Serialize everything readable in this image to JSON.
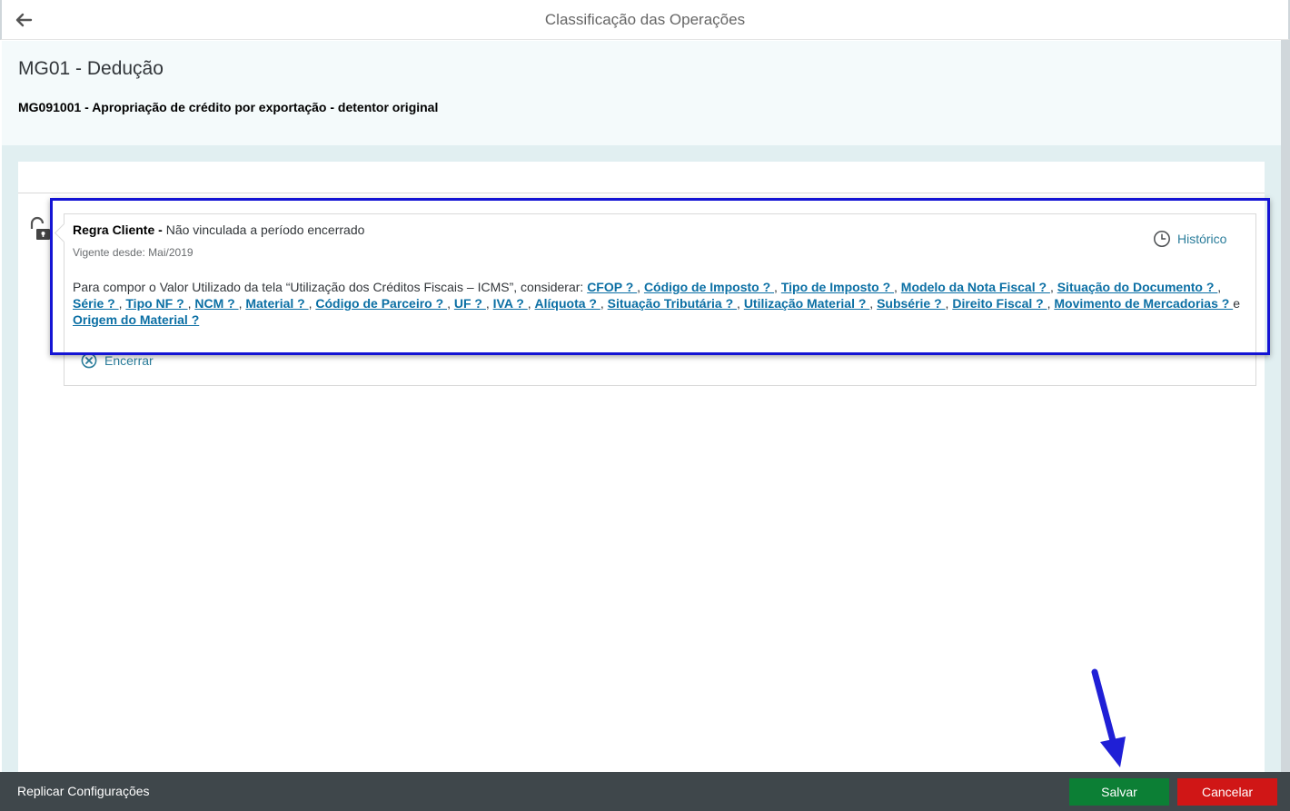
{
  "header": {
    "title": "Classificação das Operações"
  },
  "object": {
    "title": "MG01 - Dedução",
    "subtitle": "MG091001 - Apropriação de crédito por exportação - detentor original"
  },
  "rule": {
    "label_strong": "Regra Cliente -",
    "label_status": " Não vinculada a período encerrado",
    "since": "Vigente desde: Mai/2019",
    "history_label": "Histórico",
    "intro": "Para compor o Valor Utilizado da tela “Utilização dos Créditos Fiscais – ICMS”, considerar: ",
    "links": [
      "CFOP ? ",
      "Código de Imposto ? ",
      "Tipo de Imposto ? ",
      "Modelo da Nota Fiscal ? ",
      "Situação do Documento ? ",
      "Série ? ",
      "Tipo NF ? ",
      "NCM ? ",
      "Material ? ",
      "Código de Parceiro ? ",
      "UF ? ",
      "IVA ? ",
      "Alíquota ? ",
      "Situação Tributária ? ",
      "Utilização Material ? ",
      "Subsérie ? ",
      "Direito Fiscal ? ",
      "Movimento de Mercadorias ? ",
      "Origem do Material ?"
    ],
    "sep": ", ",
    "and": "e ",
    "close_label": "Encerrar"
  },
  "footer": {
    "replicate_label": "Replicar Configurações",
    "save_label": "Salvar",
    "cancel_label": "Cancelar"
  },
  "colors": {
    "save": "#0c7f35",
    "cancel": "#d01616",
    "link": "#0b6fa4",
    "highlight": "#1414d4"
  },
  "icons": {
    "back": "arrow-left-icon",
    "lock": "unlocked-icon",
    "history": "clock-icon",
    "close": "circle-x-icon"
  }
}
